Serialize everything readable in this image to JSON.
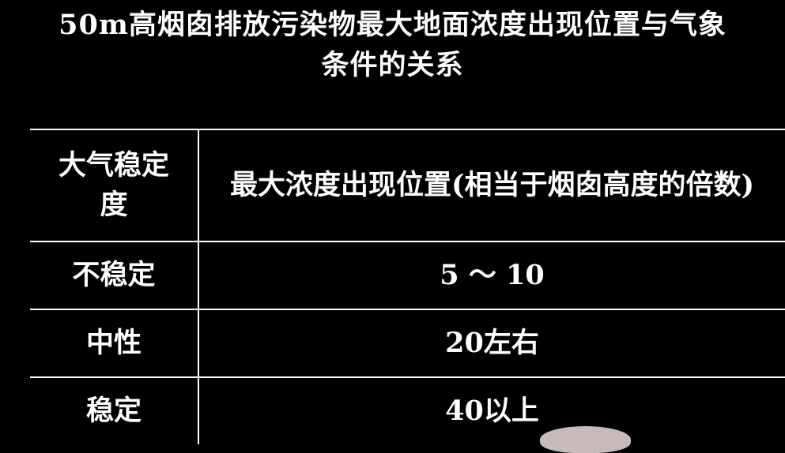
{
  "title": {
    "line1": "50m高烟囱排放污染物最大地面浓度出现位置与气象",
    "line2": "条件的关系"
  },
  "table": {
    "headers": [
      "大气稳定度",
      "最大浓度出现位置(相当于烟囱高度的倍数)"
    ],
    "rows": [
      [
        "不稳定",
        "5 ～ 10"
      ],
      [
        "中性",
        "20左右"
      ],
      [
        "稳定",
        "40以上"
      ]
    ]
  },
  "colors": {
    "background": "#000000",
    "text": "#ffffff",
    "rule": "#ffffff"
  }
}
